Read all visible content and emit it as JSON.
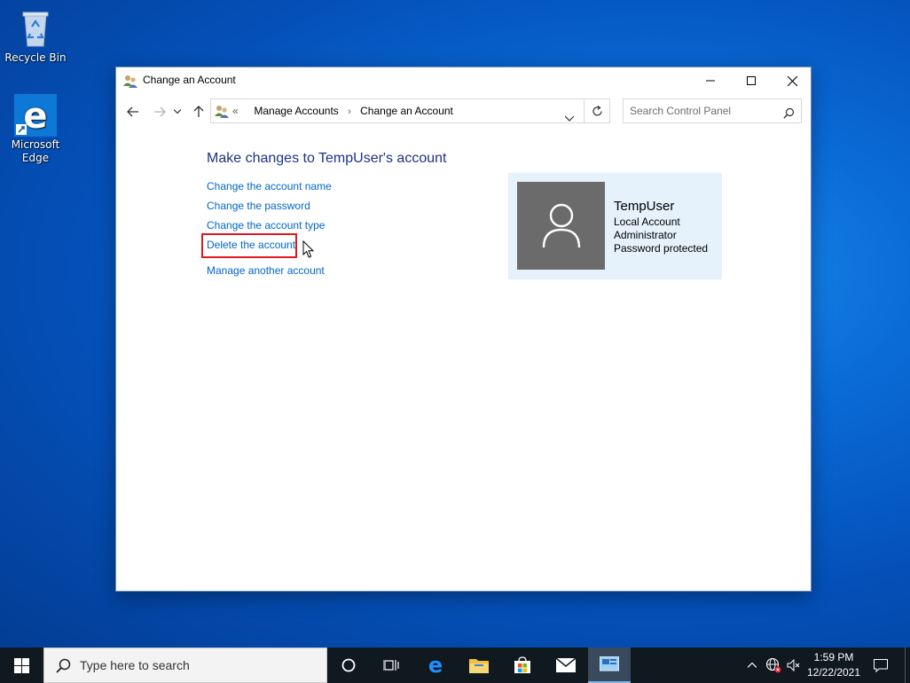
{
  "desktop": {
    "icons": [
      {
        "label": "Recycle Bin"
      },
      {
        "label": "Microsoft Edge"
      }
    ]
  },
  "window": {
    "title": "Change an Account",
    "breadcrumb": {
      "overflow": "«",
      "items": [
        "Manage Accounts",
        "Change an Account"
      ]
    },
    "search_placeholder": "Search Control Panel",
    "heading": "Make changes to TempUser's account",
    "links": [
      "Change the account name",
      "Change the password",
      "Change the account type",
      "Delete the account",
      "Manage another account"
    ],
    "user": {
      "name": "TempUser",
      "details": [
        "Local Account",
        "Administrator",
        "Password protected"
      ]
    }
  },
  "taskbar": {
    "search_text": "Type here to search",
    "time": "1:59 PM",
    "date": "12/22/2021"
  },
  "colors": {
    "link": "#0066cc",
    "heading": "#1e3287",
    "highlight": "#e0191f",
    "card_bg": "#e5f1fb",
    "taskbar": "#101820"
  }
}
